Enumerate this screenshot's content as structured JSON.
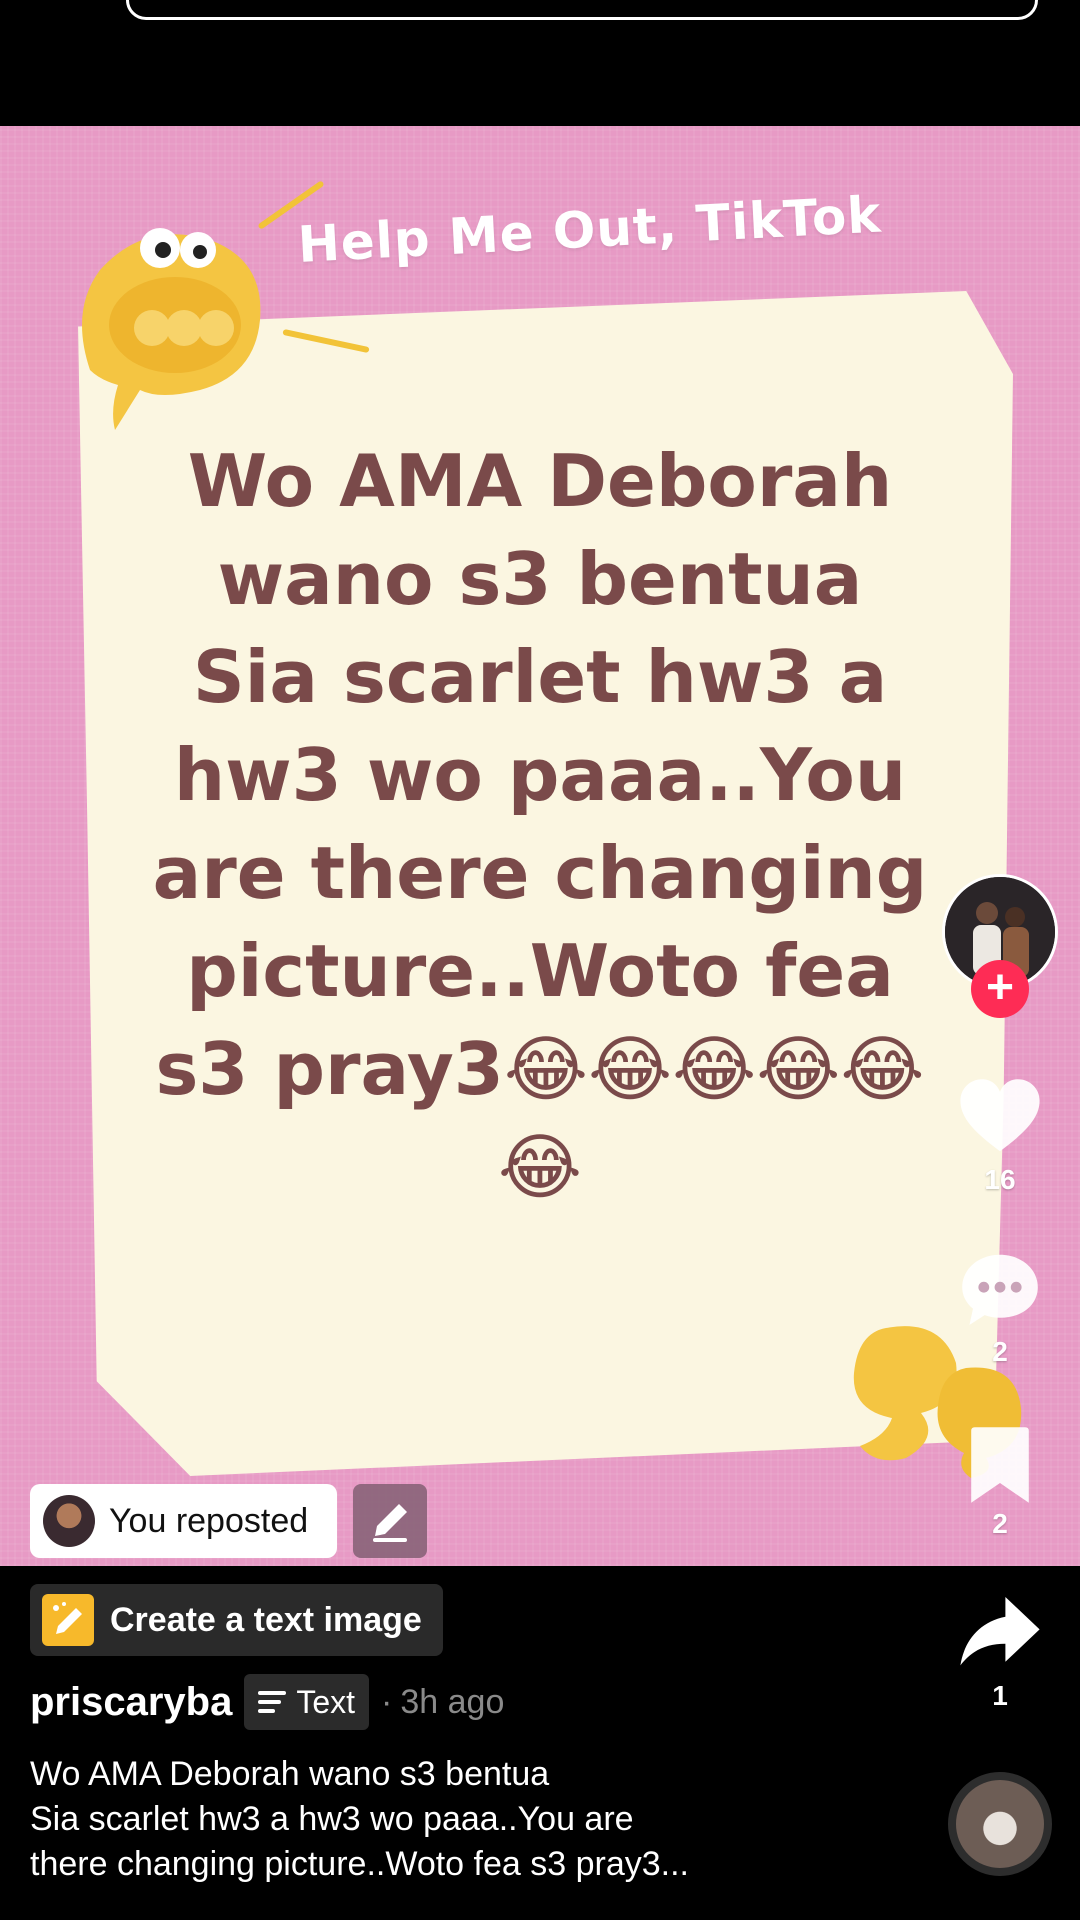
{
  "post": {
    "header_text": "Help  Me Out, TikTok",
    "main_text": "Wo AMA Deborah wano s3 bentua Sia scarlet hw3 a hw3 wo paaa..You are there changing picture..Woto fea s3 pray3😂😂😂😂😂😂",
    "background_color": "#e79ac5",
    "card_color": "#fbf6e1",
    "text_color": "#7a4a4a"
  },
  "rail": {
    "follow_symbol": "+",
    "likes": "16",
    "comments": "2",
    "saves": "2",
    "shares": "1",
    "icons": [
      "avatar",
      "plus-icon",
      "heart-icon",
      "comment-icon",
      "bookmark-icon",
      "share-icon",
      "sound-disc"
    ]
  },
  "repost": {
    "label": "You reposted"
  },
  "text_image": {
    "label": "Create a text image"
  },
  "author": {
    "username": "priscaryba",
    "badge": "Text",
    "separator": "·",
    "time": "3h ago"
  },
  "caption": {
    "line1": "Wo AMA Deborah wano s3 bentua",
    "line2": "Sia scarlet hw3 a hw3 wo paaa..You are",
    "line3": "there changing picture..Woto fea s3 pray3..."
  },
  "colors": {
    "accent_red": "#fe2c55",
    "pencil_yellow": "#f7b92b"
  }
}
